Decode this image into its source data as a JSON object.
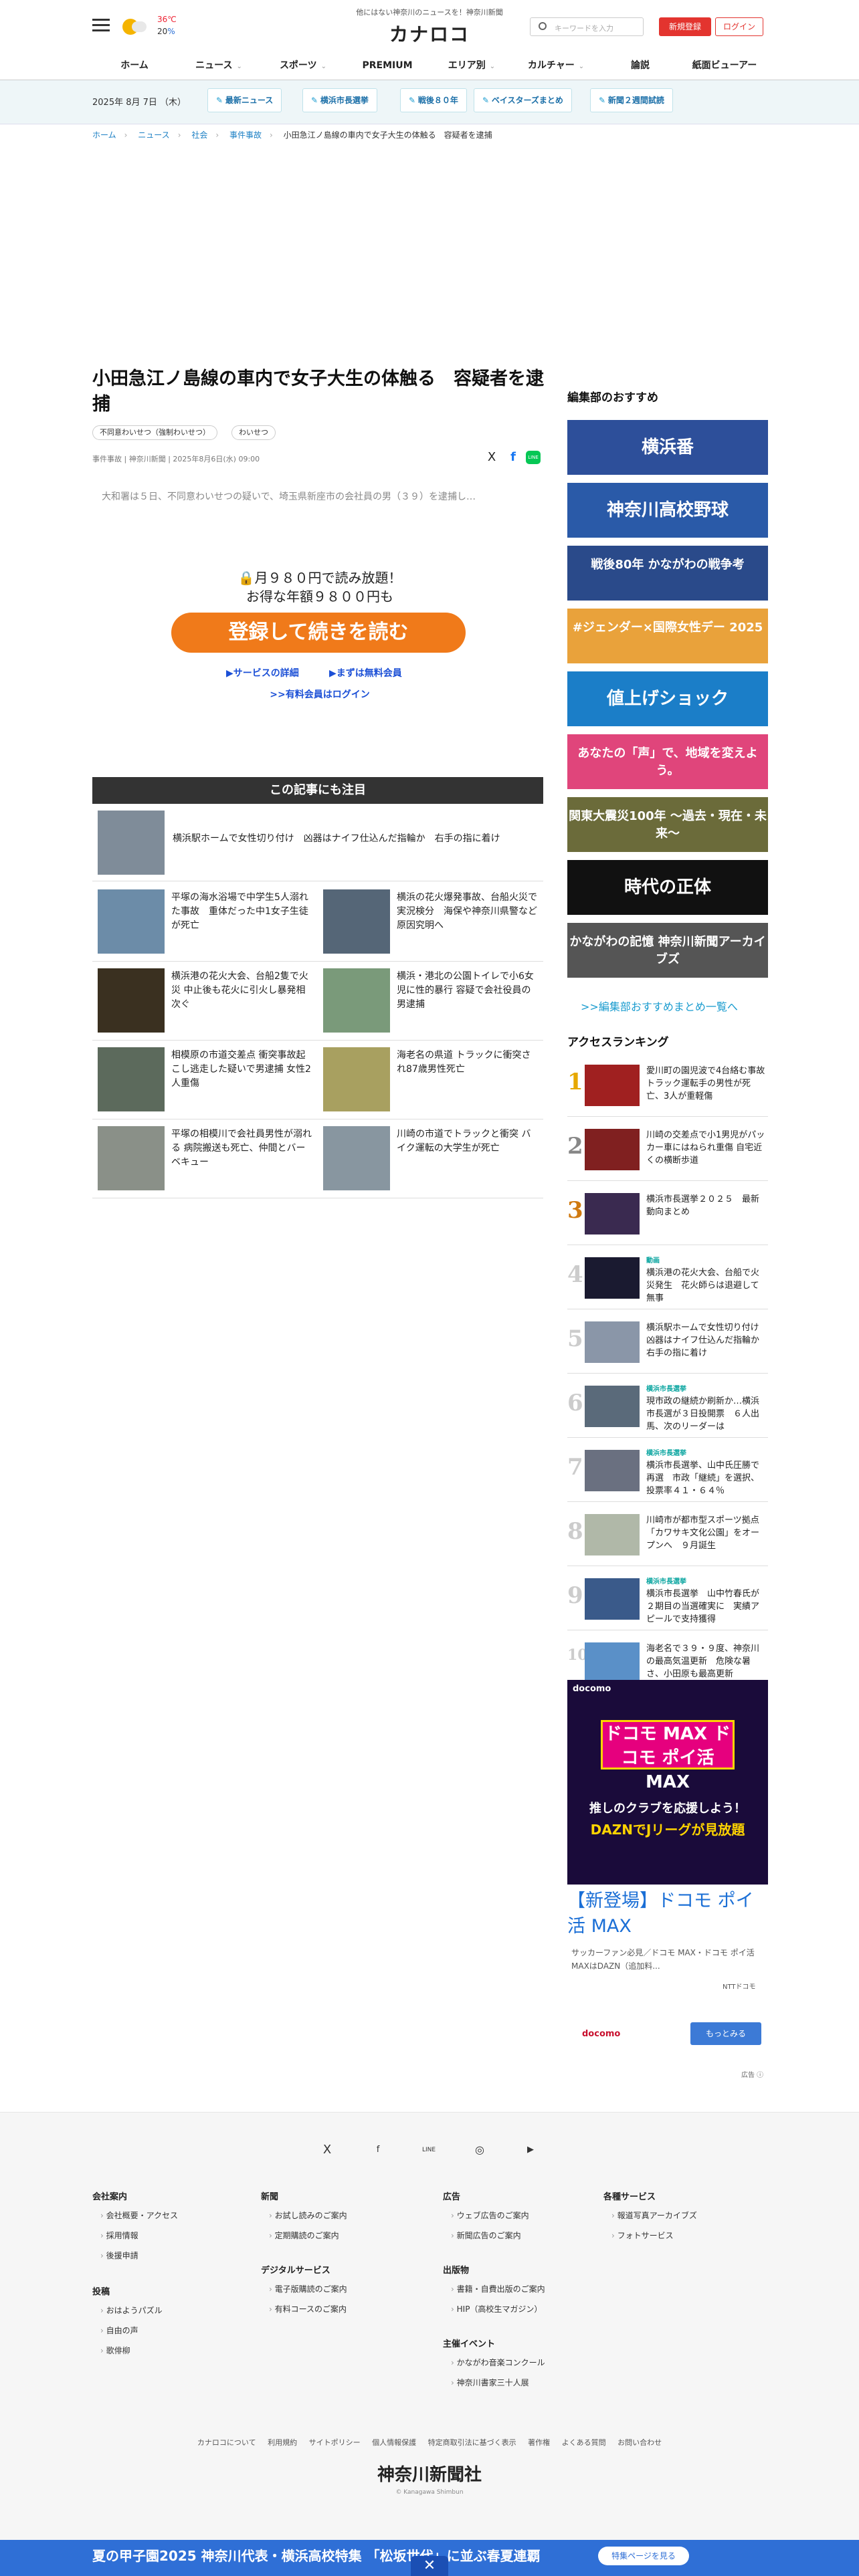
{
  "header": {
    "tagline": "他にはない神奈川のニュースを！神奈川新聞",
    "logo": "カナロコ",
    "weather": {
      "high": "36",
      "high_unit": "℃",
      "low": "20",
      "low_unit": "%"
    },
    "search_placeholder": "キーワードを入力",
    "signup_label": "新規登録",
    "login_label": "ログイン",
    "nav": [
      "ホーム",
      "ニュース",
      "スポーツ",
      "PREMIUM",
      "エリア別",
      "カルチャー",
      "論説",
      "紙面ビューアー"
    ],
    "nav_chevron": "⌄"
  },
  "topics": {
    "date": "2025年 8月 7日 （木）",
    "items": [
      "最新ニュース",
      "横浜市長選挙",
      "戦後８０年",
      "ベイスターズまとめ",
      "新聞２週間試読"
    ]
  },
  "breadcrumb": [
    "ホーム",
    "ニュース",
    "社会",
    "事件事故",
    "小田急江ノ島線の車内で女子大生の体触る　容疑者を逮捕"
  ],
  "breadcrumb_sep": "›",
  "article": {
    "title": "小田急江ノ島線の車内で女子大生の体触る　容疑者を逮捕",
    "tags": [
      "不同意わいせつ（強制わいせつ）",
      "わいせつ"
    ],
    "byline": "事件事故 | 神奈川新聞 | 2025年8月6日(水) 09:00",
    "share": [
      "X",
      "f",
      "LINE"
    ],
    "lead": "大和署は５日、不同意わいせつの疑いで、埼玉県新座市の会社員の男（３９）を逮捕し…",
    "paywall_line1": "🔒月９８０円で読み放題！",
    "paywall_line2": "お得な年額９８００円も",
    "cta": "登録して続きを読む",
    "service_link": "▶サービスの詳細",
    "free_link": "▶まずは無料会員",
    "member_login": ">>有料会員はログイン"
  },
  "related": {
    "heading": "この記事にも注目",
    "top": "横浜駅ホームで女性切り付け　凶器はナイフ仕込んだ指輪か　右手の指に着け",
    "items": [
      "平塚の海水浴場で中学生5人溺れた事故　重体だった中1女子生徒が死亡",
      "横浜の花火爆発事故、台船火災で実況検分　海保や神奈川県警など原因究明へ",
      "横浜港の花火大会、台船2隻で火災 中止後も花火に引火し暴発相次ぐ",
      "横浜・港北の公園トイレで小6女児に性的暴行 容疑で会社役員の男逮捕",
      "相模原の市道交差点 衝突事故起こし逃走した疑いで男逮捕 女性2人重傷",
      "海老名の県道 トラックに衝突され87歳男性死亡",
      "平塚の相模川で会社員男性が溺れる 病院搬送も死亡、仲間とバーベキュー",
      "川崎の市道でトラックと衝突 バイク運転の大学生が死亡"
    ]
  },
  "sidebar": {
    "heading": "編集部のおすすめ",
    "banners": [
      {
        "text": "横浜番",
        "color": "#2d4f9a"
      },
      {
        "text": "神奈川高校野球",
        "color": "#2a5aa8"
      },
      {
        "text": "戦後80年 かながわの戦争考",
        "color": "#2a4a8a"
      },
      {
        "text": "#ジェンダー×国際女性デー 2025",
        "color": "#e9a23b"
      },
      {
        "text": "値上げショック",
        "color": "#1b7ec8"
      },
      {
        "text": "あなたの「声」で、地域を変えよう。",
        "color": "#e0457b"
      },
      {
        "text": "関東大震災100年 〜過去・現在・未来〜",
        "color": "#6b6b3a"
      },
      {
        "text": "時代の正体",
        "color": "#111111"
      },
      {
        "text": "かながわの記憶 神奈川新聞アーカイブズ",
        "color": "#555555"
      }
    ],
    "more": ">>編集部おすすめまとめ一覧へ",
    "ranking_heading": "アクセスランキング",
    "ranking": [
      {
        "num": "1",
        "cat": "",
        "text": "愛川町の園児波で4台絡む事故　トラック運転手の男性が死亡、3人が重軽傷"
      },
      {
        "num": "2",
        "cat": "",
        "text": "川崎の交差点で小1男児がパッカー車にはねられ重傷 自宅近くの横断歩道"
      },
      {
        "num": "3",
        "cat": "",
        "text": "横浜市長選挙２０２５　最新動向まとめ"
      },
      {
        "num": "4",
        "cat": "動画",
        "text": "横浜港の花火大会、台船で火災発生　花火師らは退避して無事"
      },
      {
        "num": "5",
        "cat": "",
        "text": "横浜駅ホームで女性切り付け　凶器はナイフ仕込んだ指輪か　右手の指に着け"
      },
      {
        "num": "6",
        "cat": "横浜市長選挙",
        "text": "現市政の継続か刷新か…横浜市長選が３日投開票　６人出馬、次のリーダーは"
      },
      {
        "num": "7",
        "cat": "横浜市長選挙",
        "text": "横浜市長選挙、山中氏圧勝で再選　市政「継続」を選択、投票率４１・６４％"
      },
      {
        "num": "8",
        "cat": "",
        "text": "川崎市が都市型スポーツ拠点「カワサキ文化公園」をオープンへ　９月誕生"
      },
      {
        "num": "9",
        "cat": "横浜市長選挙",
        "text": "横浜市長選挙　山中竹春氏が２期目の当選確実に　実績アピールで支持獲得"
      },
      {
        "num": "10",
        "cat": "",
        "text": "海老名で３９・９度、神奈川の最高気温更新　危険な暑さ、小田原も最高更新"
      }
    ]
  },
  "ad": {
    "brand": "docomo",
    "max_label": "ドコモ MAX ドコモ ポイ活 MAX",
    "copy1": "推しのクラブを応援しよう！",
    "copy2": "DAZNでJリーグが見放題",
    "title": "【新登場】ドコモ ポイ活 MAX",
    "desc": "サッカーファン必見／ドコモ MAX・ドコモ ポイ活 MAXはDAZN（追加料...",
    "advertiser": "NTTドコモ",
    "logo": "docomo",
    "more": "もっとみる",
    "info": "広告 ⓘ"
  },
  "footer": {
    "social": [
      "X",
      "f",
      "LINE",
      "◎",
      "▶"
    ],
    "columns": [
      {
        "heading": "会社案内",
        "links": [
          "会社概要・アクセス",
          "採用情報",
          "後援申請"
        ]
      },
      {
        "heading": "投稿",
        "links": [
          "おはようパズル",
          "自由の声",
          "歌俳柳"
        ]
      },
      {
        "heading": "新聞",
        "links": [
          "お試し読みのご案内",
          "定期購読のご案内"
        ]
      },
      {
        "heading": "デジタルサービス",
        "links": [
          "電子版購読のご案内",
          "有料コースのご案内"
        ]
      },
      {
        "heading": "広告",
        "links": [
          "ウェブ広告のご案内",
          "新聞広告のご案内"
        ]
      },
      {
        "heading": "出版物",
        "links": [
          "書籍・自費出版のご案内",
          "HIP（高校生マガジン）"
        ]
      },
      {
        "heading": "主催イベント",
        "links": [
          "かながわ音楽コンクール",
          "神奈川書家三十人展"
        ]
      },
      {
        "heading": "各種サービス",
        "links": [
          "報道写真アーカイブズ",
          "フォトサービス"
        ]
      }
    ],
    "bottom_links": [
      "カナロコについて",
      "利用規約",
      "サイトポリシー",
      "個人情報保護",
      "特定商取引法に基づく表示",
      "著作権",
      "よくある質問",
      "お問い合わせ"
    ],
    "logo": "神奈川新聞社",
    "copyright": "© Kanagawa Shimbun"
  },
  "bottom_banner": {
    "text": "夏の甲子園2025 神奈川代表・横浜高校特集 「松坂世代」に並ぶ春夏連覇",
    "button": "特集ページを見る",
    "close": "✕"
  }
}
